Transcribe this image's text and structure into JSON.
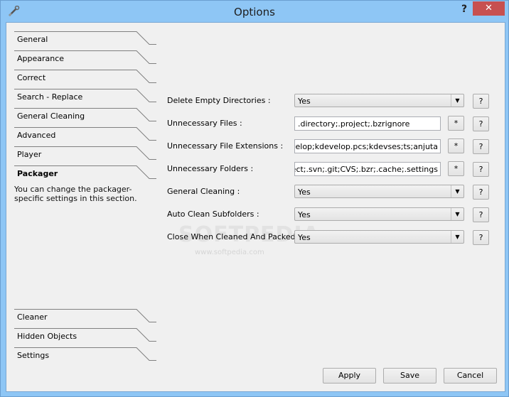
{
  "window": {
    "title": "Options",
    "help_label": "?",
    "close_label": "✕"
  },
  "nav": {
    "top_items": [
      {
        "label": "General"
      },
      {
        "label": "Appearance"
      },
      {
        "label": "Correct"
      },
      {
        "label": "Search - Replace"
      },
      {
        "label": "General Cleaning"
      },
      {
        "label": "Advanced"
      },
      {
        "label": "Player"
      },
      {
        "label": "Packager",
        "active": true
      }
    ],
    "active_description": "You can change the packager-specific settings in this section.",
    "bottom_items": [
      {
        "label": "Cleaner"
      },
      {
        "label": "Hidden Objects"
      },
      {
        "label": "Settings"
      }
    ]
  },
  "form": {
    "rows": [
      {
        "label": "Delete Empty Directories :",
        "type": "combo",
        "value": "Yes",
        "help": "?"
      },
      {
        "label": "Unnecessary Files :",
        "type": "text",
        "value": ".directory;.project;.bzrignore",
        "star": "*",
        "help": "?"
      },
      {
        "label": "Unnecessary File Extensions :",
        "type": "text",
        "value": "kdevelop;kdevelop.pcs;kdevses;ts;anjuta",
        "star": "*",
        "help": "?"
      },
      {
        "label": "Unnecessary Folders :",
        "type": "text",
        "value": ".project;.svn;.git;CVS;.bzr;.cache;.settings",
        "star": "*",
        "help": "?"
      },
      {
        "label": "General Cleaning :",
        "type": "combo",
        "value": "Yes",
        "help": "?"
      },
      {
        "label": "Auto Clean Subfolders :",
        "type": "combo",
        "value": "Yes",
        "help": "?"
      },
      {
        "label": "Close When Cleaned And Packed? :",
        "type": "combo",
        "value": "Yes",
        "help": "?"
      }
    ]
  },
  "watermark": {
    "text": "SOFTPEDIA",
    "url": "www.softpedia.com"
  },
  "buttons": {
    "apply": "Apply",
    "save": "Save",
    "cancel": "Cancel"
  },
  "colors": {
    "frame": "#8ec6f5",
    "close": "#c75050",
    "client": "#f0f0f0"
  }
}
